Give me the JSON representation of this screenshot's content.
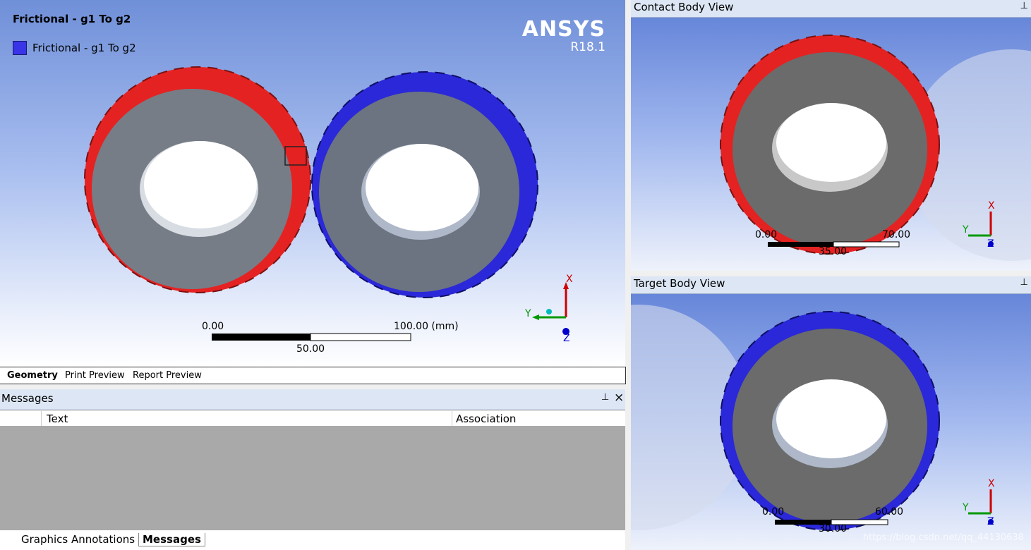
{
  "main_view": {
    "title": "Frictional - g1 To g2",
    "legend_label": "Frictional - g1 To g2",
    "legend_color": "#3a34e8",
    "brand": "ANSYS",
    "version": "R18.1",
    "scale": {
      "start": "0.00",
      "mid": "50.00",
      "end": "100.00 (mm)"
    },
    "triad": {
      "x": "X",
      "y": "Y",
      "z": "Z"
    }
  },
  "view_tabs": [
    "Geometry",
    "Print Preview",
    "Report Preview"
  ],
  "messages": {
    "title": "Messages",
    "pin": "⊥",
    "close": "×",
    "columns": [
      "Text",
      "Association"
    ]
  },
  "bottom_tabs": [
    "Graphics Annotations",
    "Messages"
  ],
  "contact_view": {
    "title": "Contact Body View",
    "scale": {
      "start": "0.00",
      "mid": "35.00",
      "end": "70.00"
    },
    "triad": {
      "x": "X",
      "y": "Y",
      "z": "Z"
    }
  },
  "target_view": {
    "title": "Target Body View",
    "scale": {
      "start": "0.00",
      "mid": "30.00",
      "end": "60.00"
    },
    "triad": {
      "x": "X",
      "y": "Y",
      "z": "Z"
    },
    "watermark": "https://blog.csdn.net/qq_44130638"
  },
  "colors": {
    "contact": "#e52222",
    "target": "#2a28d8",
    "gear_face": "#6b7480"
  }
}
